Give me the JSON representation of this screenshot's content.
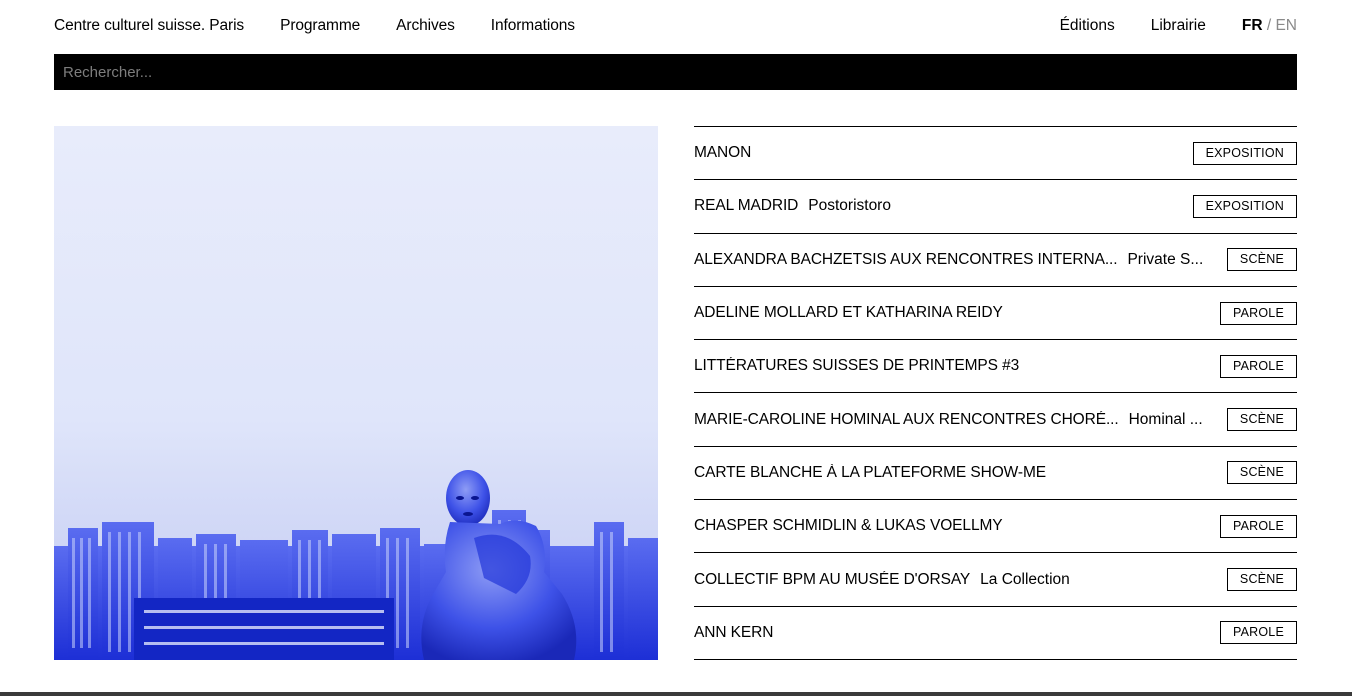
{
  "nav": {
    "brand": "Centre culturel suisse. Paris",
    "items": [
      "Programme",
      "Archives",
      "Informations"
    ],
    "right_items": [
      "Éditions",
      "Librairie"
    ],
    "lang_active": "FR",
    "lang_sep": " / ",
    "lang_inactive": "EN"
  },
  "search": {
    "placeholder": "Rechercher..."
  },
  "hero": {
    "tint_color": "#1f3cff"
  },
  "events": [
    {
      "title": "MANON",
      "subtitle": "",
      "tag": "EXPOSITION"
    },
    {
      "title": "REAL MADRID",
      "subtitle": "Postoristoro",
      "tag": "EXPOSITION"
    },
    {
      "title": "ALEXANDRA BACHZETSIS AUX RENCONTRES INTERNA...",
      "subtitle": "Private S...",
      "tag": "SCÈNE"
    },
    {
      "title": "ADELINE MOLLARD ET KATHARINA REIDY",
      "subtitle": "",
      "tag": "PAROLE"
    },
    {
      "title": "LITTÉRATURES SUISSES DE PRINTEMPS #3",
      "subtitle": "",
      "tag": "PAROLE"
    },
    {
      "title": "MARIE-CAROLINE HOMINAL AUX RENCONTRES CHORÉ...",
      "subtitle": "Hominal ...",
      "tag": "SCÈNE"
    },
    {
      "title": "CARTE BLANCHE À LA PLATEFORME SHOW-ME",
      "subtitle": "",
      "tag": "SCÈNE"
    },
    {
      "title": "CHASPER SCHMIDLIN & LUKAS VOELLMY",
      "subtitle": "",
      "tag": "PAROLE"
    },
    {
      "title": "COLLECTIF BPM AU MUSÉE D'ORSAY",
      "subtitle": "La Collection",
      "tag": "SCÈNE"
    },
    {
      "title": "ANN KERN",
      "subtitle": "",
      "tag": "PAROLE"
    }
  ]
}
